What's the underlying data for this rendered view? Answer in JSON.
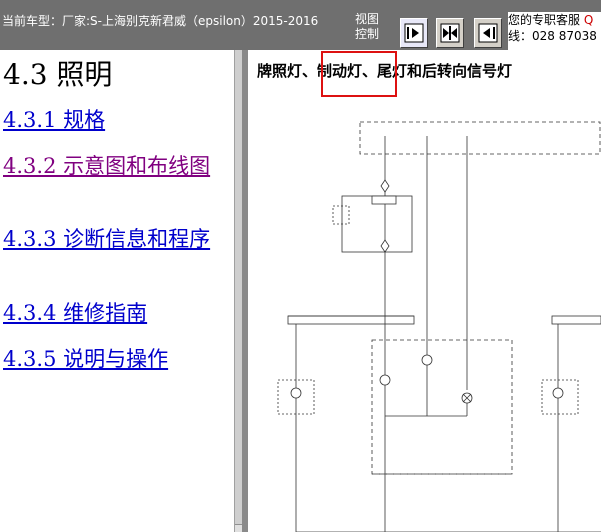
{
  "topbar": {
    "vehicle_label": "当前车型：厂家:S-上海别克新君威（epsilon）2015-2016",
    "view_line1": "视图",
    "view_line2": "控制",
    "service_label": "您的专职客服",
    "service_q": "Q",
    "service_phone": "线：028 87038"
  },
  "leftpane": {
    "heading": "4.3  照明",
    "toc": [
      {
        "label": "4.3.1  规格"
      },
      {
        "label": "4.3.2  示意图和布线图"
      },
      {
        "label": "4.3.3  诊断信息和程序"
      },
      {
        "label": "4.3.4  维修指南"
      },
      {
        "label": "4.3.5  说明与操作"
      }
    ]
  },
  "rightpane": {
    "title": "牌照灯、制动灯、尾灯和后转向信号灯"
  },
  "colors": {
    "link": "#0000cc",
    "visited": "#800080",
    "highlight": "#dd1111"
  }
}
